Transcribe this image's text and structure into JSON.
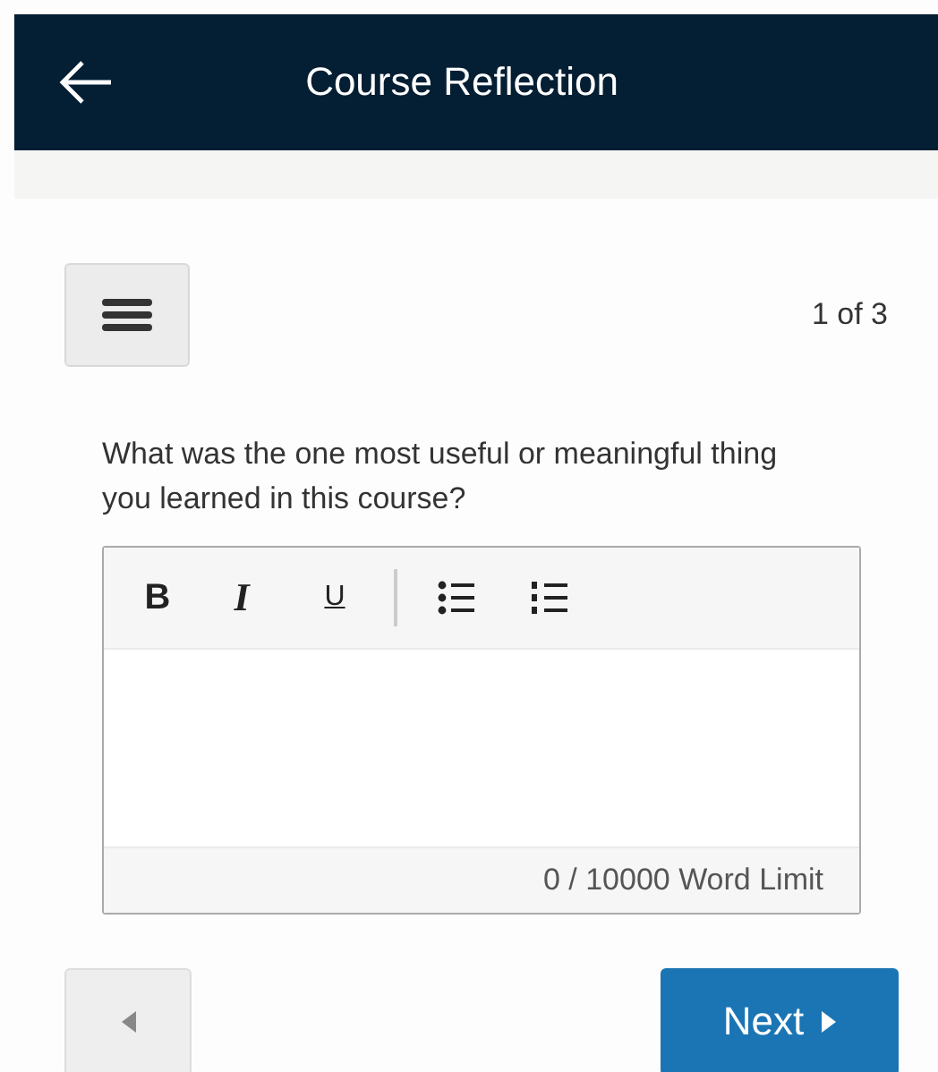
{
  "header": {
    "title": "Course Reflection"
  },
  "progress": {
    "text": "1 of 3"
  },
  "question": {
    "text": "What was the one most useful or meaningful thing you learned in this course?"
  },
  "editor": {
    "toolbar": [
      {
        "kind": "bold",
        "label": "B"
      },
      {
        "kind": "italic",
        "label": "I"
      },
      {
        "kind": "underline",
        "label": "U"
      },
      {
        "kind": "separator"
      },
      {
        "kind": "bullet-list"
      },
      {
        "kind": "numbered-list"
      }
    ],
    "word_limit": "0 / 10000 Word Limit"
  },
  "navigation": {
    "previous": {
      "disabled": true
    },
    "next": {
      "label": "Next",
      "disabled": false
    }
  }
}
